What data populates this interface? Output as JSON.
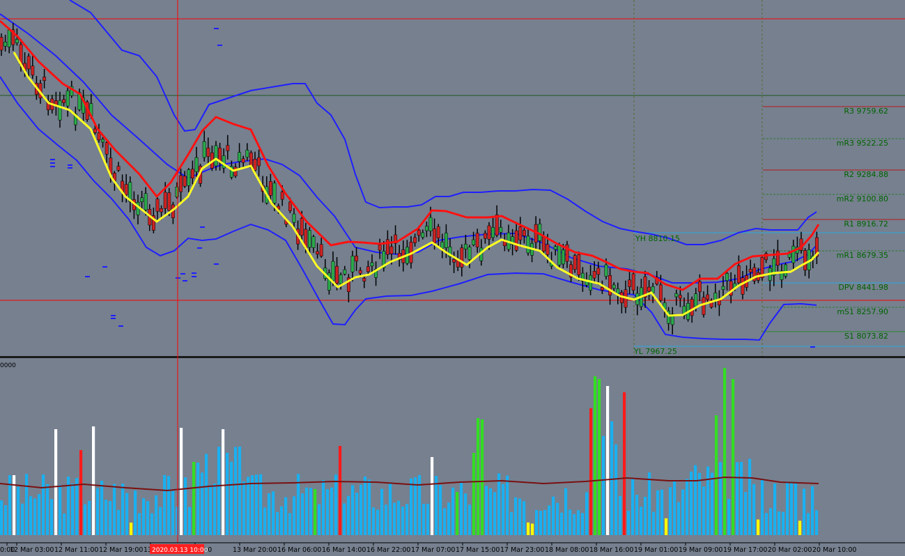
{
  "colors": {
    "background": "#76808f",
    "bull_candle": "#2aa84a",
    "bear_candle": "#cc2222",
    "wick": "#000000",
    "bollinger": "#1f1fff",
    "ma_fast": "#ff1111",
    "ma_slow": "#ffff22",
    "pivot_line": "#2aa8e0",
    "pivot_label": "#006400",
    "volume_normal": "#1ab0f0",
    "volume_green": "#33dd22",
    "volume_red": "#ff1a1a",
    "volume_white": "#ffffff",
    "volume_yellow": "#ffff00",
    "volume_ma": "#7a1010",
    "crosshair": "#ff0000",
    "date_badge": "#ff2020"
  },
  "pivot_levels": [
    {
      "label": "R3 9759.62",
      "style": "solid-red"
    },
    {
      "label": "mR3 9522.25",
      "style": "dotted-green"
    },
    {
      "label": "R2 9284.88",
      "style": "solid-red"
    },
    {
      "label": "mR2 9100.80",
      "style": "dotted-green"
    },
    {
      "label": "R1 8916.72",
      "style": "solid-red"
    },
    {
      "label": "mR1 8679.35",
      "style": "dotted-green"
    },
    {
      "label": "DPV 8441.98",
      "style": "solid-blue"
    },
    {
      "label": "mS1 8257.90",
      "style": "dotted-green"
    },
    {
      "label": "S1 8073.82",
      "style": "solid-green"
    }
  ],
  "yesterday_high": "YH 8810.15",
  "yesterday_low": "YL 7967.25",
  "volume_panel_label": "0000",
  "time_axis_labels": [
    "0:00",
    "12 Mar 03:00",
    "12 Mar 11:00",
    "12 Mar 19:00",
    "13",
    "r 12:00",
    "13 Mar 20:00",
    "16 Mar 06:00",
    "16 Mar 14:00",
    "16 Mar 22:00",
    "17 Mar 07:00",
    "17 Mar 15:00",
    "17 Mar 23:00",
    "18 Mar 08:00",
    "18 Mar 16:00",
    "19 Mar 01:00",
    "19 Mar 09:00",
    "19 Mar 17:00",
    "20 Mar 02:00",
    "20 Mar 10:00"
  ],
  "crosshair_date": "2020.03.13 10:00"
}
